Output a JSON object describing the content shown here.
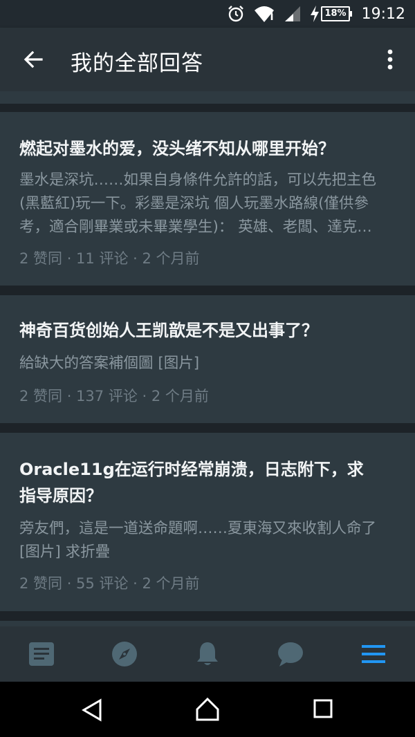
{
  "status_bar": {
    "time": "19:12",
    "battery": "18%",
    "icons": [
      "alarm-icon",
      "wifi-icon",
      "signal-icon",
      "charging-icon",
      "battery-icon"
    ]
  },
  "app_bar": {
    "title": "我的全部回答",
    "back_icon": "arrow-left-icon",
    "menu_icon": "more-vertical-icon"
  },
  "answers": [
    {
      "question": "燃起对墨水的爱，没头绪不知从哪里开始？",
      "excerpt_lines": [
        "墨水是深坑……如果自身條件允許的話，可以先把主色",
        "(黑藍紅)玩一下。彩墨是深坑 個人玩墨水路線(僅供參",
        "考，適合剛畢業或未畢業學生)： 英雄、老闆、達克…"
      ],
      "meta": "2 赞同 · 11 评论 · 2 个月前"
    },
    {
      "question": "神奇百货创始人王凯歆是不是又出事了？",
      "excerpt_lines": [
        "給缺大的答案補個圖 [图片]"
      ],
      "meta": "2 赞同 · 137 评论 · 2 个月前"
    },
    {
      "question_lines": [
        "Oracle11g在运行时经常崩溃，日志附下，求",
        "指导原因？"
      ],
      "excerpt_lines": [
        "旁友們，這是一道送命題啊……夏東海又來收割人命了",
        "[图片] 求折疊"
      ],
      "meta": "2 赞同 · 55 评论 · 2 个月前"
    }
  ],
  "bottom_nav": [
    {
      "name": "feed",
      "icon": "article-icon",
      "active": false
    },
    {
      "name": "explore",
      "icon": "compass-icon",
      "active": false
    },
    {
      "name": "notifications",
      "icon": "bell-icon",
      "active": false
    },
    {
      "name": "messages",
      "icon": "chat-bubble-icon",
      "active": false
    },
    {
      "name": "more",
      "icon": "hamburger-menu-icon",
      "active": true
    }
  ],
  "colors": {
    "active_tab": "#2196f3",
    "inactive_tab": "#4f6874",
    "card_bg": "#2e3a41",
    "appbar_bg": "#2a3339"
  },
  "system_nav": [
    "back-triangle-icon",
    "home-icon",
    "recents-icon"
  ]
}
